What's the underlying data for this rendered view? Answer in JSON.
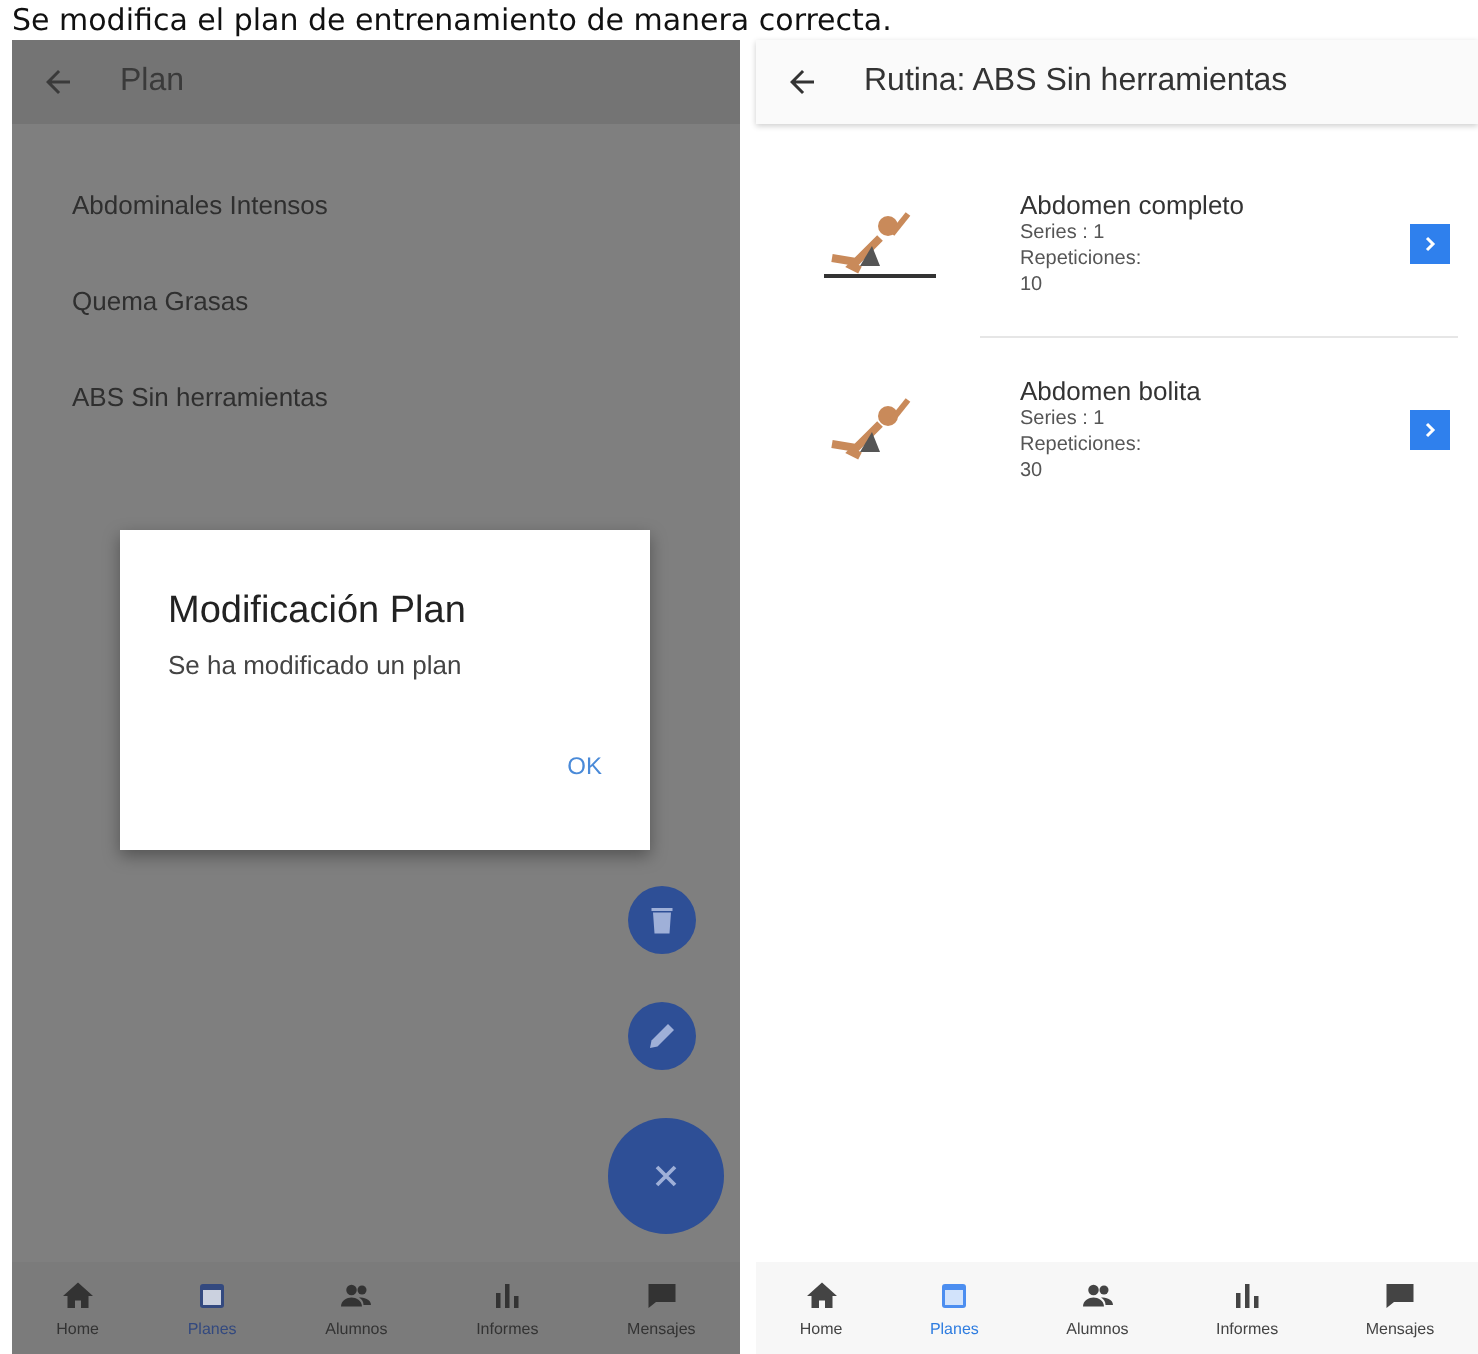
{
  "caption": "Se modifica el plan de entrenamiento de manera correcta.",
  "screens": [
    {
      "kind": "plan_list",
      "dimmed": true,
      "title": "Plan",
      "items": [
        "Abdominales Intensos",
        "Quema Grasas",
        "ABS Sin herramientas"
      ],
      "dialog": {
        "title": "Modificación Plan",
        "message": "Se ha modificado un plan",
        "button": "OK"
      },
      "fabs": [
        {
          "kind": "delete"
        },
        {
          "kind": "edit"
        },
        {
          "kind": "close"
        }
      ],
      "nav": [
        {
          "kind": "home",
          "label": "Home",
          "selected": false
        },
        {
          "kind": "calendar",
          "label": "Planes",
          "selected": true
        },
        {
          "kind": "people",
          "label": "Alumnos",
          "selected": false
        },
        {
          "kind": "chart",
          "label": "Informes",
          "selected": false
        },
        {
          "kind": "chat",
          "label": "Mensajes",
          "selected": false
        }
      ]
    },
    {
      "kind": "routine",
      "dimmed": false,
      "title": "Rutina: ABS Sin herramientas",
      "exercises": [
        {
          "name": "Abdomen completo",
          "series": "Series : 1",
          "reps_label": "Repeticiones:",
          "reps": "10"
        },
        {
          "name": "Abdomen bolita",
          "series": "Series : 1",
          "reps_label": "Repeticiones:",
          "reps": "30"
        }
      ],
      "nav": [
        {
          "kind": "home",
          "label": "Home",
          "selected": false
        },
        {
          "kind": "calendar",
          "label": "Planes",
          "selected": true
        },
        {
          "kind": "people",
          "label": "Alumnos",
          "selected": false
        },
        {
          "kind": "chart",
          "label": "Informes",
          "selected": false
        },
        {
          "kind": "chat",
          "label": "Mensajes",
          "selected": false
        }
      ]
    }
  ]
}
